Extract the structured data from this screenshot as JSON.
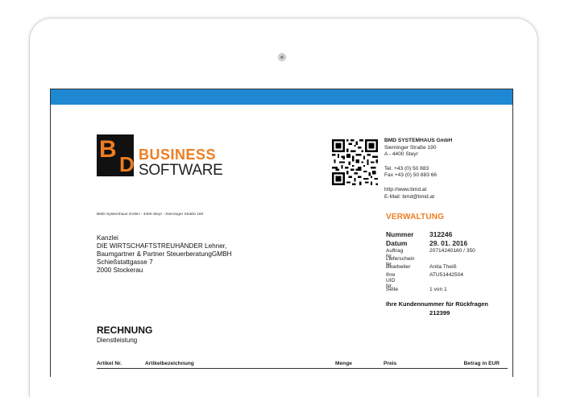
{
  "logo": {
    "line1": "BUSINESS",
    "line2": "SOFTWARE",
    "mark_b": "B",
    "mark_d": "D"
  },
  "company": {
    "name": "BMD SYSTEMHAUS GmbH",
    "street": "Sierninger Straße 190",
    "city": "A - 4400 Steyr",
    "phone": "Tel. +43 (0) 50 883",
    "fax": "Fax +43 (0) 50 883 66",
    "web": "http://www.bmd.at",
    "email": "E-Mail: bmd@bmd.at"
  },
  "sender_line": "BMD Systemhaus GmbH - 4400 Steyr - Sierninger Straße 190",
  "recipient": {
    "line1": "Kanzlei",
    "line2": "DIE WIRTSCHAFTSTREUHÄNDER Lehner,",
    "line3": "Baumgartner & Partner SteuerberatungGMBH",
    "line4": "Schießstattgasse 7",
    "line5": "2000 Stockerau"
  },
  "verwaltung": "VERWALTUNG",
  "meta": {
    "nummer_label": "Nummer",
    "nummer_value": "312246",
    "datum_label": "Datum",
    "datum_value": "29. 01. 2016",
    "auftrag_label": "Auftrag Nr.",
    "auftrag_value": "20714240160 / 350",
    "lieferschein_label": "Lieferschein Nr.",
    "bearbeiter_label": "Bearbeiter",
    "bearbeiter_value": "Anita Theiß",
    "uid_label": "Ihre UID Nr.",
    "uid_value": "ATU51442504",
    "seite_label": "Seite",
    "seite_value": "1 von 1"
  },
  "kunden": {
    "label": "Ihre Kundennummer für Rückfragen",
    "value": "212399"
  },
  "document": {
    "title": "RECHNUNG",
    "subtitle": "Dienstleistung"
  },
  "table": {
    "col_artikel_nr": "Artikel Nr.",
    "col_bezeichnung": "Artikelbezeichnung",
    "col_menge": "Menge",
    "col_preis": "Preis",
    "col_betrag": "Betrag in EUR"
  },
  "colors": {
    "accent_blue": "#1f88d3",
    "brand_orange": "#ee7d21"
  }
}
